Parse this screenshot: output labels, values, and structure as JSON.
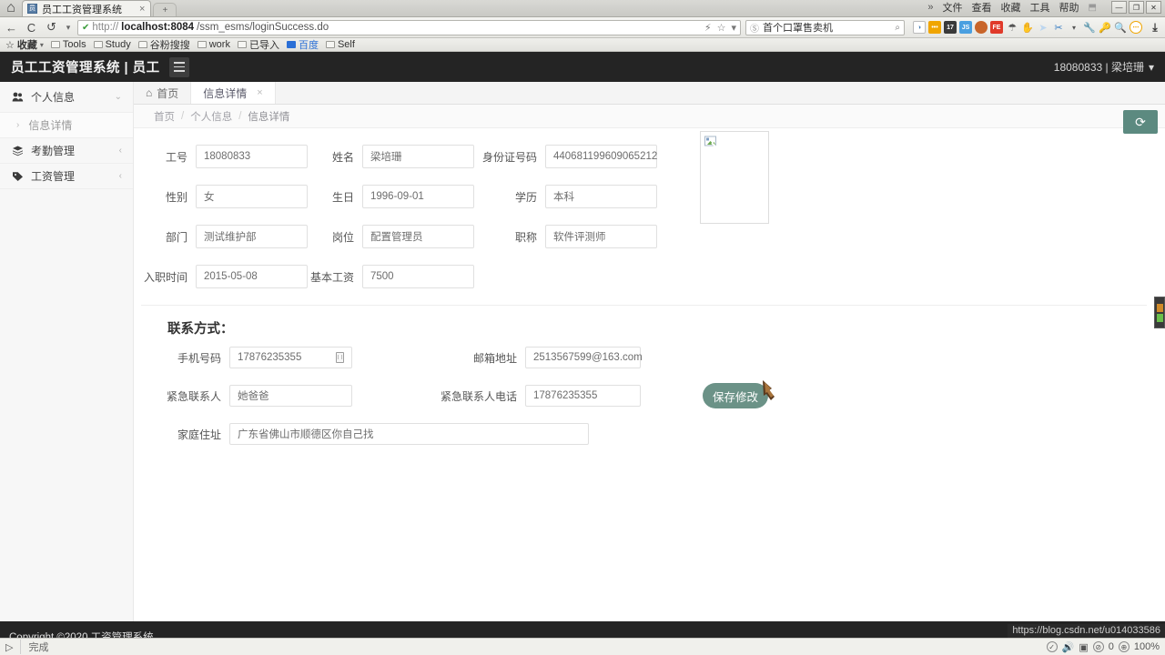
{
  "browser": {
    "tab_title": "员工工资管理系统",
    "tab_close": "×",
    "newtab": "+",
    "home_icon": "⌂",
    "menu_items": [
      "文件",
      "查看",
      "收藏",
      "工具",
      "帮助"
    ],
    "overflow": "»",
    "win_min": "—",
    "win_max": "❐",
    "win_close": "✕",
    "back": "←",
    "refresh": "C",
    "history": "↺",
    "history_caret": "▾",
    "url_scheme": "http://",
    "url_host": "localhost:8084",
    "url_path": "/ssm_esms/loginSuccess.do",
    "url_lock": "✔",
    "url_bolt": "⚡",
    "url_star": "☆",
    "url_caret": "▾",
    "search_value": "首个口罩售卖机",
    "search_engine_icon": "Ⓢ",
    "search_mag": "⌕",
    "page_mag": "⌕",
    "bookmarks_label": "收藏",
    "bookmarks": [
      "Tools",
      "Study",
      "谷粉搜搜",
      "work",
      "已导入",
      "百度",
      "Self"
    ],
    "ext_badges": [
      "0",
      "•••",
      "17",
      "JS",
      "",
      "FE",
      "",
      "",
      "",
      "",
      "",
      "",
      "",
      ""
    ],
    "download_icon": "⤓"
  },
  "app": {
    "brand": "员工工资管理系统 | 员工",
    "user": "18080833 | 梁培珊",
    "user_caret": "▾",
    "copyright": "Copyright ©2020 工资管理系统"
  },
  "sidebar": {
    "items": [
      {
        "label": "个人信息",
        "icon": "people-icon",
        "arrow": "⌄"
      },
      {
        "label": "考勤管理",
        "icon": "layers-icon",
        "arrow": "‹"
      },
      {
        "label": "工资管理",
        "icon": "tag-icon",
        "arrow": "‹"
      }
    ],
    "sub_item": {
      "label": "信息详情",
      "caret": "›"
    }
  },
  "tabs": [
    {
      "label": "首页",
      "icon": "⌂",
      "active": false,
      "closable": false
    },
    {
      "label": "信息详情",
      "icon": "",
      "active": true,
      "closable": true,
      "close": "×"
    }
  ],
  "breadcrumb": {
    "items": [
      "首页",
      "个人信息",
      "信息详情"
    ],
    "separator": "/"
  },
  "refresh_button": {
    "icon": "⟳",
    "color": "#5c8a80"
  },
  "form": {
    "rows": [
      [
        {
          "label": "工号",
          "value": "18080833"
        },
        {
          "label": "姓名",
          "value": "梁培珊"
        },
        {
          "label": "身份证号码",
          "value": "440681199609065212"
        }
      ],
      [
        {
          "label": "性别",
          "value": "女"
        },
        {
          "label": "生日",
          "value": "1996-09-01"
        },
        {
          "label": "学历",
          "value": "本科"
        }
      ],
      [
        {
          "label": "部门",
          "value": "测试维护部"
        },
        {
          "label": "岗位",
          "value": "配置管理员"
        },
        {
          "label": "职称",
          "value": "软件评测师"
        }
      ],
      [
        {
          "label": "入职时间",
          "value": "2015-05-08"
        },
        {
          "label": "基本工资",
          "value": "7500"
        },
        {
          "label": "",
          "value": ""
        }
      ]
    ],
    "photo_alt": "broken-image"
  },
  "contact": {
    "title": "联系方式：",
    "phone": {
      "label": "手机号码",
      "value": "17876235355",
      "icon": "mobile-icon"
    },
    "email": {
      "label": "邮箱地址",
      "value": "2513567599@163.com"
    },
    "emergency_name": {
      "label": "紧急联系人",
      "value": "她爸爸"
    },
    "emergency_phone": {
      "label": "紧急联系人电话",
      "value": "17876235355"
    },
    "address": {
      "label": "家庭住址",
      "value": "广东省佛山市顺德区你自己找"
    },
    "save_label": "保存修改"
  },
  "statusbar": {
    "play_icon": "▷",
    "text": "完成",
    "hover_url": "https://blog.csdn.net/u014033586",
    "count": "0",
    "zoom": "100%"
  }
}
